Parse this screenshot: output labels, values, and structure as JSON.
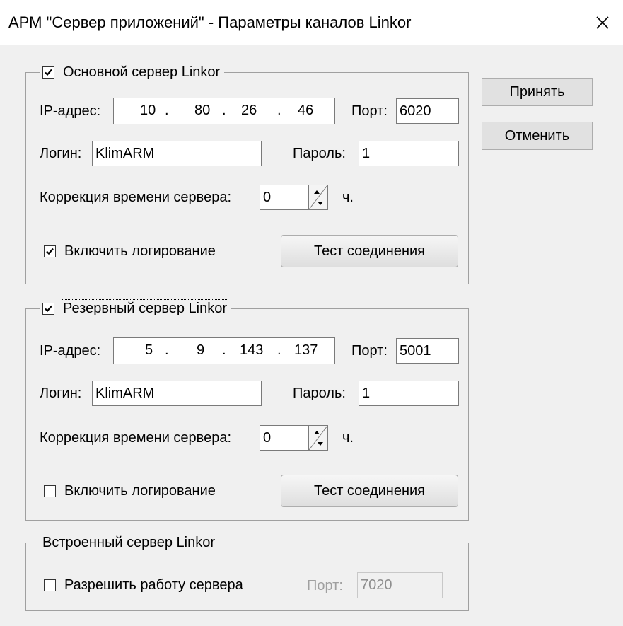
{
  "window": {
    "title": "АРМ \"Сервер приложений\" - Параметры каналов Linkor",
    "close_icon": "close-icon"
  },
  "buttons": {
    "accept": "Принять",
    "cancel": "Отменить"
  },
  "primary": {
    "legend": "Основной сервер Linkor",
    "enabled": true,
    "ip_label": "IP-адрес:",
    "ip": [
      "10",
      "80",
      "26",
      "46"
    ],
    "ip_dot": ".",
    "port_label": "Порт:",
    "port": "6020",
    "login_label": "Логин:",
    "login": "KlimARM",
    "password_label": "Пароль:",
    "password": "1",
    "time_label": "Коррекция времени сервера:",
    "time_value": "0",
    "time_unit": "ч.",
    "logging_label": "Включить логирование",
    "logging": true,
    "test_button": "Тест соединения"
  },
  "backup": {
    "legend": "Резервный сервер Linkor",
    "enabled": true,
    "ip_label": "IP-адрес:",
    "ip": [
      "5",
      "9",
      "143",
      "137"
    ],
    "ip_dot": ".",
    "port_label": "Порт:",
    "port": "5001",
    "login_label": "Логин:",
    "login": "KlimARM",
    "password_label": "Пароль:",
    "password": "1",
    "time_label": "Коррекция времени сервера:",
    "time_value": "0",
    "time_unit": "ч.",
    "logging_label": "Включить логирование",
    "logging": false,
    "test_button": "Тест соединения"
  },
  "builtin": {
    "legend": "Встроенный сервер Linkor",
    "allow_label": "Разрешить работу сервера",
    "allow": false,
    "port_label": "Порт:",
    "port": "7020"
  }
}
